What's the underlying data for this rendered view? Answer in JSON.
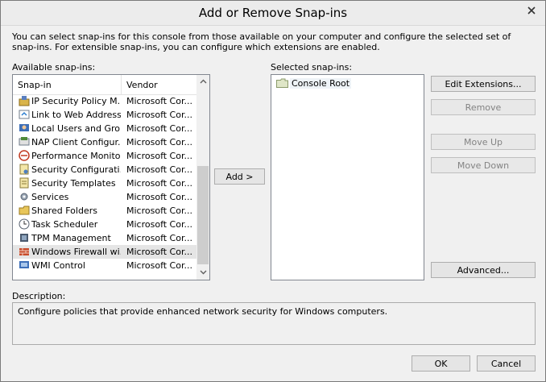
{
  "dialog": {
    "title": "Add or Remove Snap-ins",
    "intro": "You can select snap-ins for this console from those available on your computer and configure the selected set of snap-ins. For extensible snap-ins, you can configure which extensions are enabled."
  },
  "available": {
    "label": "Available snap-ins:",
    "col_snapin": "Snap-in",
    "col_vendor": "Vendor",
    "rows": [
      {
        "name": "IP Security Policy M...",
        "vendor": "Microsoft Cor...",
        "icon": "ip-security-icon"
      },
      {
        "name": "Link to Web Address",
        "vendor": "Microsoft Cor...",
        "icon": "web-link-icon"
      },
      {
        "name": "Local Users and Gro...",
        "vendor": "Microsoft Cor...",
        "icon": "users-icon"
      },
      {
        "name": "NAP Client Configur...",
        "vendor": "Microsoft Cor...",
        "icon": "nap-client-icon"
      },
      {
        "name": "Performance Monitor",
        "vendor": "Microsoft Cor...",
        "icon": "performance-monitor-icon"
      },
      {
        "name": "Security Configurati...",
        "vendor": "Microsoft Cor...",
        "icon": "security-config-icon"
      },
      {
        "name": "Security Templates",
        "vendor": "Microsoft Cor...",
        "icon": "security-templates-icon"
      },
      {
        "name": "Services",
        "vendor": "Microsoft Cor...",
        "icon": "services-gear-icon"
      },
      {
        "name": "Shared Folders",
        "vendor": "Microsoft Cor...",
        "icon": "shared-folders-icon"
      },
      {
        "name": "Task Scheduler",
        "vendor": "Microsoft Cor...",
        "icon": "task-scheduler-icon"
      },
      {
        "name": "TPM Management",
        "vendor": "Microsoft Cor...",
        "icon": "tpm-chip-icon"
      },
      {
        "name": "Windows Firewall wi...",
        "vendor": "Microsoft Cor...",
        "icon": "firewall-icon"
      },
      {
        "name": "WMI Control",
        "vendor": "Microsoft Cor...",
        "icon": "wmi-control-icon"
      }
    ]
  },
  "selected": {
    "label": "Selected snap-ins:",
    "items": [
      {
        "name": "Console Root",
        "icon": "folder-icon"
      }
    ]
  },
  "buttons": {
    "add": "Add >",
    "edit_extensions": "Edit Extensions...",
    "remove": "Remove",
    "move_up": "Move Up",
    "move_down": "Move Down",
    "advanced": "Advanced...",
    "ok": "OK",
    "cancel": "Cancel"
  },
  "description": {
    "label": "Description:",
    "text": "Configure policies that provide enhanced network security for Windows computers."
  }
}
